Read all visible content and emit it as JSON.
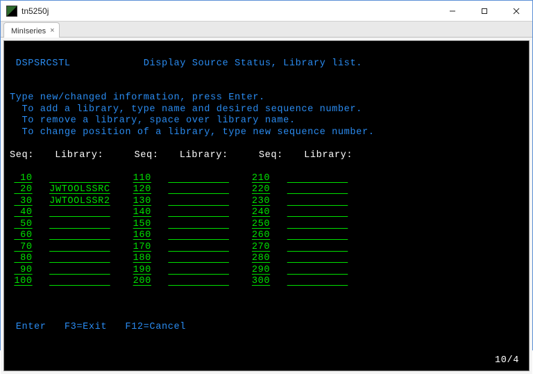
{
  "window": {
    "title": "tn5250j"
  },
  "tab": {
    "label": "MinIseries",
    "close_glyph": "×"
  },
  "screen": {
    "program": "DSPSRCSTL",
    "title": "Display Source Status, Library list.",
    "instr1": "Type new/changed information, press Enter.",
    "instr2": "  To add a library, type name and desired sequence number.",
    "instr3": "  To remove a library, space over library name.",
    "instr4": "  To change position of a library, type new sequence number.",
    "hdr_seq": "Seq:",
    "hdr_lib": "Library:"
  },
  "cols": [
    {
      "rows": [
        {
          "seq": " 10",
          "lib": "          "
        },
        {
          "seq": " 20",
          "lib": "JWTOOLSSRC"
        },
        {
          "seq": " 30",
          "lib": "JWTOOLSSR2"
        },
        {
          "seq": " 40",
          "lib": "          "
        },
        {
          "seq": " 50",
          "lib": "          "
        },
        {
          "seq": " 60",
          "lib": "          "
        },
        {
          "seq": " 70",
          "lib": "          "
        },
        {
          "seq": " 80",
          "lib": "          "
        },
        {
          "seq": " 90",
          "lib": "          "
        },
        {
          "seq": "100",
          "lib": "          "
        }
      ]
    },
    {
      "rows": [
        {
          "seq": "110",
          "lib": "          "
        },
        {
          "seq": "120",
          "lib": "          "
        },
        {
          "seq": "130",
          "lib": "          "
        },
        {
          "seq": "140",
          "lib": "          "
        },
        {
          "seq": "150",
          "lib": "          "
        },
        {
          "seq": "160",
          "lib": "          "
        },
        {
          "seq": "170",
          "lib": "          "
        },
        {
          "seq": "180",
          "lib": "          "
        },
        {
          "seq": "190",
          "lib": "          "
        },
        {
          "seq": "200",
          "lib": "          "
        }
      ]
    },
    {
      "rows": [
        {
          "seq": "210",
          "lib": "          "
        },
        {
          "seq": "220",
          "lib": "          "
        },
        {
          "seq": "230",
          "lib": "          "
        },
        {
          "seq": "240",
          "lib": "          "
        },
        {
          "seq": "250",
          "lib": "          "
        },
        {
          "seq": "260",
          "lib": "          "
        },
        {
          "seq": "270",
          "lib": "          "
        },
        {
          "seq": "280",
          "lib": "          "
        },
        {
          "seq": "290",
          "lib": "          "
        },
        {
          "seq": "300",
          "lib": "          "
        }
      ]
    }
  ],
  "fkeys": "Enter   F3=Exit   F12=Cancel",
  "cursor": "10/4"
}
